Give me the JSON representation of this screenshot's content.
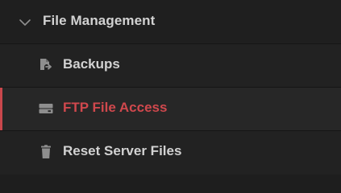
{
  "section": {
    "title": "File Management",
    "expanded": true
  },
  "items": [
    {
      "label": "Backups",
      "icon": "backup-icon",
      "active": false
    },
    {
      "label": "FTP File Access",
      "icon": "ftp-drive-icon",
      "active": true
    },
    {
      "label": "Reset Server Files",
      "icon": "trash-icon",
      "active": false
    }
  ],
  "colors": {
    "background": "#1e1e1e",
    "text": "#d2d2d2",
    "active": "#d0484d",
    "icon": "#8e8e8e"
  }
}
